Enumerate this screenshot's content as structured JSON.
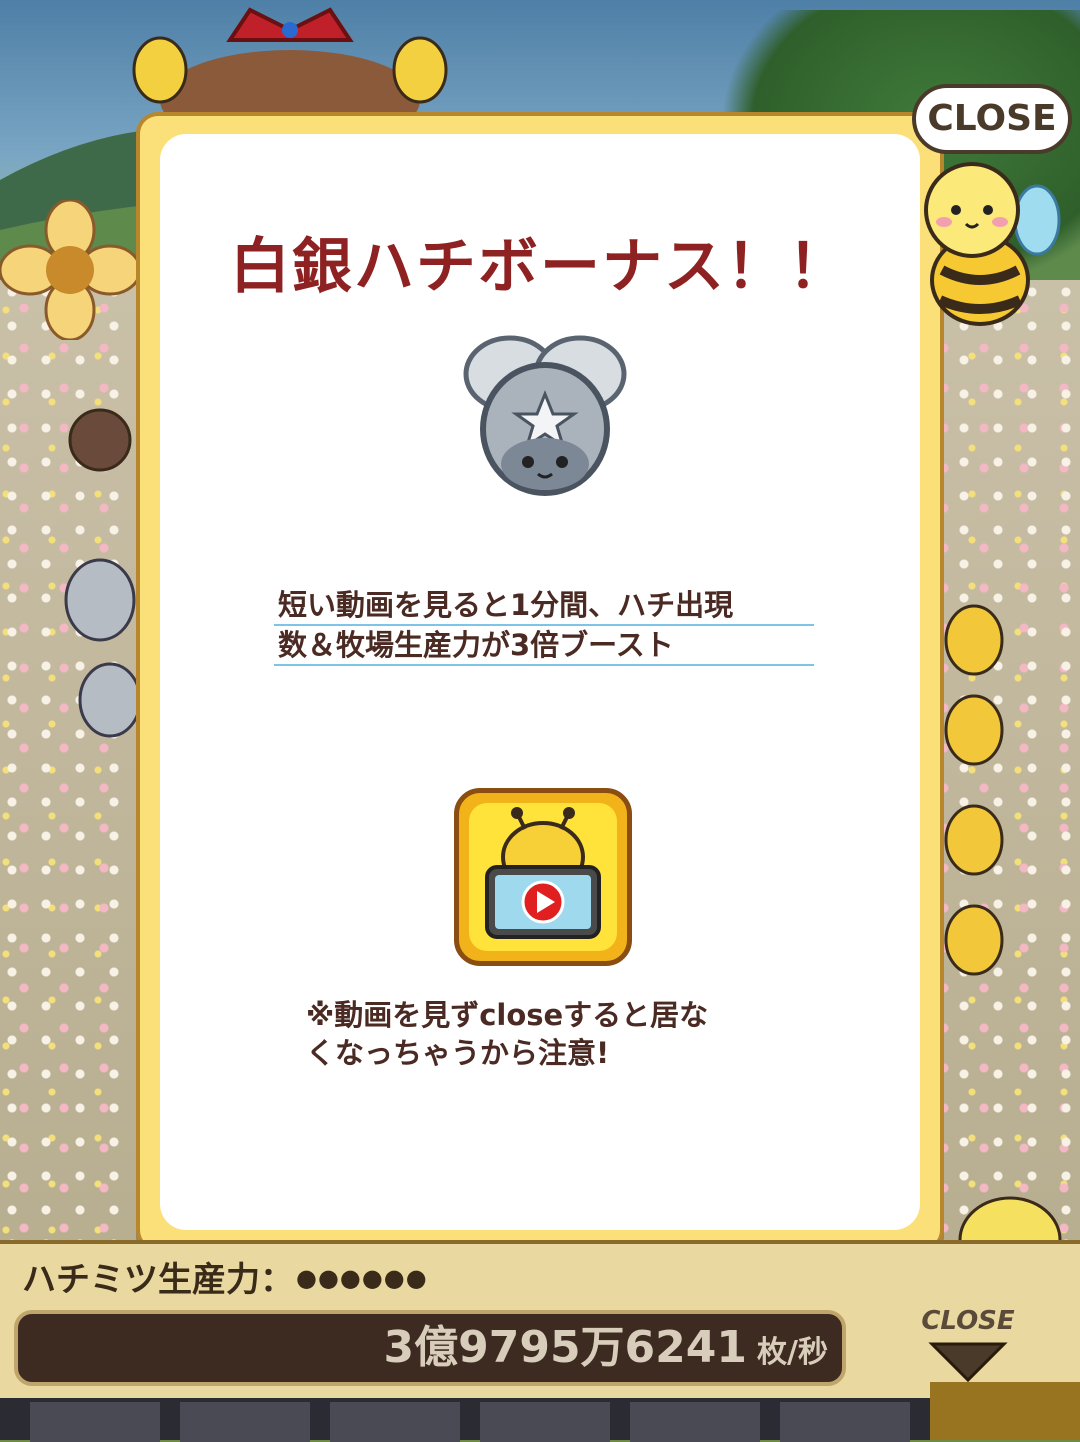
{
  "modal": {
    "title": "白銀ハチボーナス！！",
    "description_line1": "短い動画を見ると1分間、ハチ出現",
    "description_line2": "数＆牧場生産力が3倍ブースト",
    "note_line1": "※動画を見ずcloseすると居な",
    "note_line2": "くなっちゃうから注意!",
    "silver_bee_icon": "silver-bee-icon",
    "video_button_icon": "bee-video-play-icon"
  },
  "close_bubble": {
    "label": "CLOSE"
  },
  "bottom_panel": {
    "production_label": "ハチミツ生産力：",
    "production_dots": "●●●●●●",
    "honey_count": "3億9795万6241",
    "honey_unit": "枚/秒",
    "close_tab_label": "CLOSE"
  },
  "colors": {
    "title": "#8e2222",
    "frame": "#fbe07a",
    "text": "#4a2a22",
    "underline": "#7ec4e6",
    "video_button": "#f2b21a"
  }
}
